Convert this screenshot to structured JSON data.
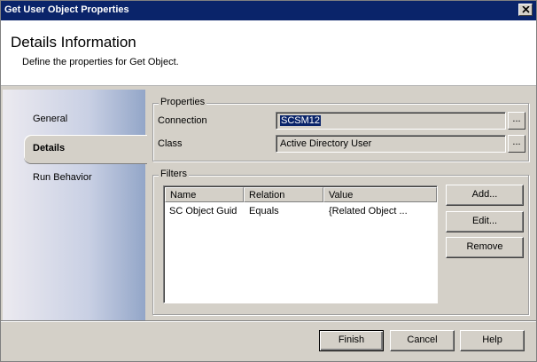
{
  "window": {
    "title": "Get User Object Properties"
  },
  "header": {
    "title": "Details Information",
    "subtitle": "Define the properties for Get Object."
  },
  "nav": {
    "items": [
      {
        "label": "General",
        "selected": false
      },
      {
        "label": "Details",
        "selected": true
      },
      {
        "label": "Run Behavior",
        "selected": false
      }
    ]
  },
  "properties": {
    "legend": "Properties",
    "connection_label": "Connection",
    "connection_value": "SCSM12",
    "class_label": "Class",
    "class_value": "Active Directory User",
    "browse_label": "..."
  },
  "filters": {
    "legend": "Filters",
    "columns": [
      "Name",
      "Relation",
      "Value"
    ],
    "rows": [
      {
        "name": "SC Object Guid",
        "relation": "Equals",
        "value": "{Related Object ..."
      }
    ],
    "add_label": "Add...",
    "edit_label": "Edit...",
    "remove_label": "Remove"
  },
  "footer": {
    "finish_label": "Finish",
    "cancel_label": "Cancel",
    "help_label": "Help"
  }
}
